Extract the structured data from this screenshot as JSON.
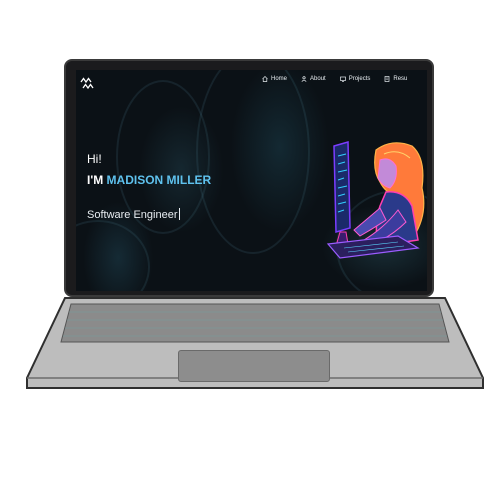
{
  "nav": {
    "logo_letters": "MM",
    "items": [
      {
        "label": "Home",
        "icon": "home-icon"
      },
      {
        "label": "About",
        "icon": "user-icon"
      },
      {
        "label": "Projects",
        "icon": "projects-icon"
      },
      {
        "label": "Resu",
        "icon": "resume-icon"
      }
    ]
  },
  "hero": {
    "greeting": "Hi!",
    "intro_prefix": "I'M ",
    "name": "MADISON MILLER",
    "role": "Software Engineer"
  },
  "colors": {
    "accent": "#5fc2ee",
    "screen_bg": "#0b1116",
    "laptop_body": "#b9b9b9"
  }
}
